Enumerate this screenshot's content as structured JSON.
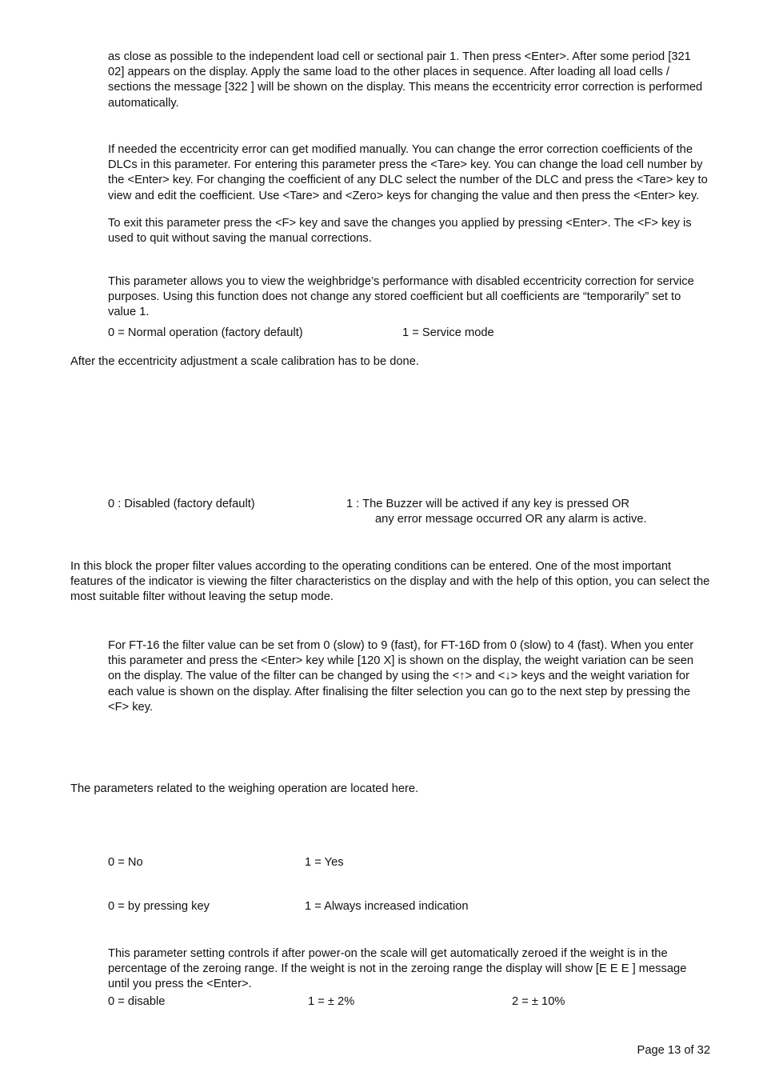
{
  "document": {
    "page_label": "Page 13 of 32"
  },
  "body": {
    "para_eccentricity_intro": "as close as possible to the independent load cell or sectional pair 1. Then press <Enter>. After some period [321  02] appears on the display. Apply the same load to the other places in sequence. After loading all load cells / sections the message [322    ] will be shown on the display. This means the eccentricity error correction is performed automatically.",
    "para_manual_correction": "If needed the eccentricity error can get modified manually. You can change the error correction coefficients of the DLCs in this parameter. For entering this parameter press the <Tare> key. You can change the load cell number by the <Enter> key. For changing the coefficient of any DLC select the number of the DLC and press the <Tare> key to view and edit the coefficient. Use <Tare> and <Zero> keys for changing the value and then press the <Enter> key.",
    "para_manual_correction_exit": "To exit this parameter press the <F> key and save the changes you applied by pressing <Enter>. The <F> key is used to quit without saving the manual corrections.",
    "para_service_mode": "This parameter allows you to view the weighbridge’s performance with disabled eccentricity correction for service purposes. Using this function does not change any stored coefficient but all coefficients are “temporarily” set to value 1.",
    "para_after_eccentricity": "After the eccentricity adjustment a scale calibration has to be done.",
    "para_filter_block": "In this block the proper filter values according to the operating conditions can be entered. One of the most important features of the indicator is viewing the filter characteristics on the display and with the help of this option, you can select the most suitable filter without leaving the setup mode.",
    "para_filter_value": "For FT-16 the filter value can be set from 0 (slow) to 9 (fast), for FT-16D from 0 (slow) to 4 (fast). When you enter this parameter and press the <Enter> key while [120   X] is shown on the display, the weight variation can be seen on the display. The value of the filter can be changed by using the <↑> and <↓> keys and the weight variation for each value is shown on the display. After finalising the filter selection you can go to the next step by pressing the <F> key.",
    "para_weighing_params": "The parameters related to the weighing operation are located here.",
    "para_power_on_zero": "This parameter setting controls if after power-on the scale will get automatically zeroed if the weight is in the percentage of the zeroing range. If the weight is not in the zeroing range the display will show [E  E  E ] message until you press the <Enter>."
  },
  "options": {
    "service_mode": {
      "opt0": "0 = Normal operation (factory default)",
      "opt1": "1 = Service mode"
    },
    "buzzer": {
      "opt0": "0   : Disabled (factory default)",
      "opt1_line1": "1   : The Buzzer will be actived if any key is pressed OR",
      "opt1_line2": "any error message occurred OR any alarm is active."
    },
    "yes_no": {
      "opt0": "0 =  No",
      "opt1": "1 =  Yes"
    },
    "indication": {
      "opt0": "0 =  by pressing key",
      "opt1": "1 =  Always increased indication"
    },
    "power_on_zero": {
      "opt0": "0 = disable",
      "opt1": "1 = ± 2%",
      "opt2": "2 = ± 10%"
    }
  }
}
